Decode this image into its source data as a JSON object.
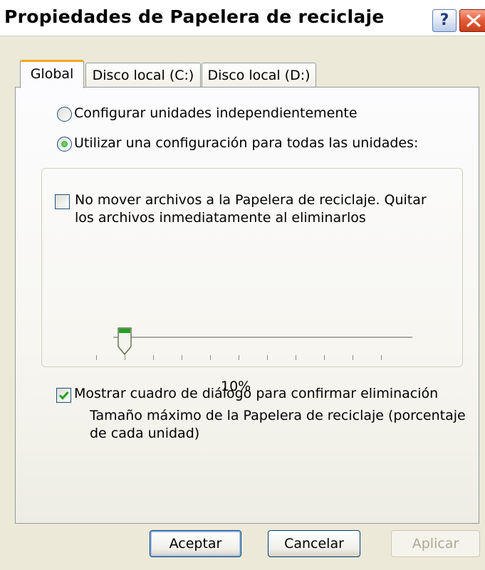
{
  "window": {
    "title": "Propiedades de Papelera de reciclaje",
    "help_glyph": "?",
    "close_icon": "close-icon"
  },
  "tabs": [
    {
      "label": "Global",
      "active": true
    },
    {
      "label": "Disco local (C:)",
      "active": false
    },
    {
      "label": "Disco local (D:)",
      "active": false
    }
  ],
  "options": {
    "configure_independently": {
      "label": "Configurar unidades independientemente",
      "selected": false
    },
    "use_one_setting": {
      "label": "Utilizar una configuración para todas las unidades:",
      "selected": true
    }
  },
  "group": {
    "no_move": {
      "label_line1": "No mover archivos a la Papelera de reciclaje. Quitar",
      "label_line2": "los archivos inmediatamente al eliminarlos",
      "checked": false
    },
    "slider": {
      "value_percent": 10,
      "value_text": "10%",
      "tick_count": 11
    },
    "size_caption_line1": "Tamaño máximo de la Papelera de reciclaje (porcentaje",
    "size_caption_line2": "de cada unidad)"
  },
  "confirm_delete": {
    "label": "Mostrar cuadro de diálogo para confirmar eliminación",
    "checked": true
  },
  "buttons": {
    "ok": "Aceptar",
    "cancel": "Cancelar",
    "apply": "Aplicar"
  },
  "colors": {
    "accent_tab": "#F4A81C",
    "close_red": "#E25B39",
    "check_green": "#21A121",
    "face": "#ECE9D8"
  }
}
